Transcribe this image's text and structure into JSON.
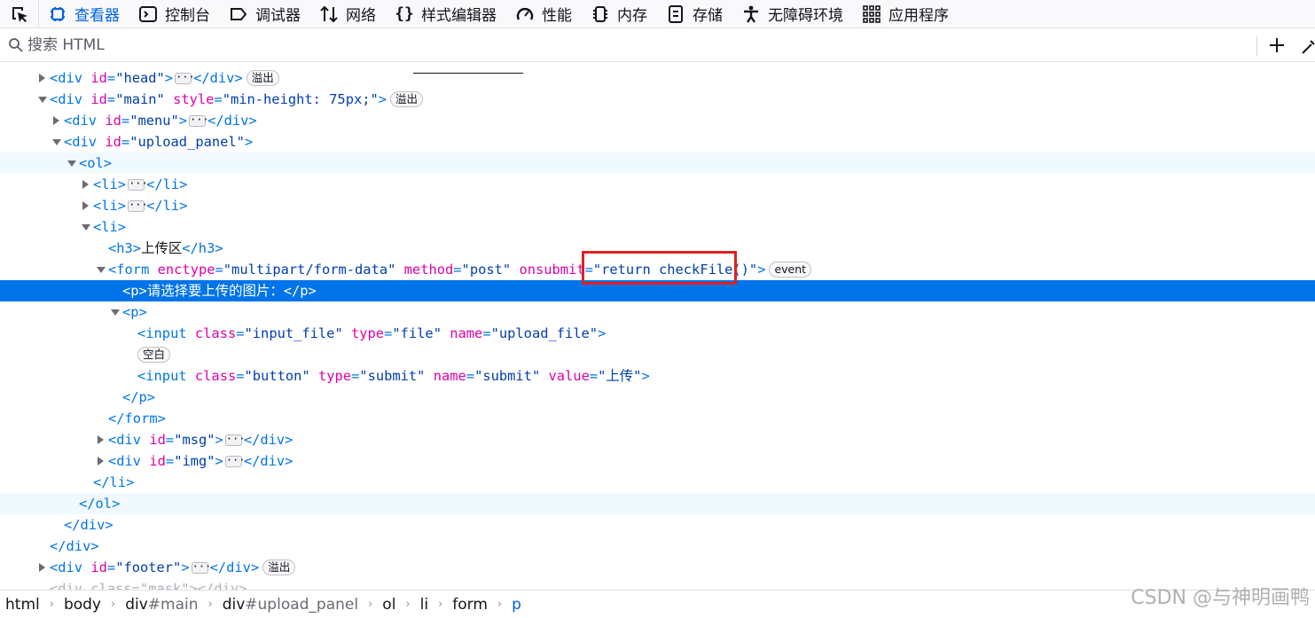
{
  "toolbar": {
    "tabs": [
      {
        "label": "查看器",
        "icon": "inspector-icon",
        "selected": true
      },
      {
        "label": "控制台",
        "icon": "console-icon"
      },
      {
        "label": "调试器",
        "icon": "debugger-icon"
      },
      {
        "label": "网络",
        "icon": "network-icon"
      },
      {
        "label": "样式编辑器",
        "icon": "style-editor-icon"
      },
      {
        "label": "性能",
        "icon": "performance-icon"
      },
      {
        "label": "内存",
        "icon": "memory-icon"
      },
      {
        "label": "存储",
        "icon": "storage-icon"
      },
      {
        "label": "无障碍环境",
        "icon": "accessibility-icon"
      },
      {
        "label": "应用程序",
        "icon": "application-icon"
      }
    ]
  },
  "search": {
    "placeholder": "搜索 HTML"
  },
  "tree": {
    "head_div": {
      "tag_open": "<div",
      "attr": "id",
      "value": "\"head\"",
      "close": "</div>",
      "badge": "溢出"
    },
    "main_div": {
      "attr1": "id",
      "value1": "\"main\"",
      "attr2": "style",
      "value2": "\"min-height: 75px;\"",
      "badge": "溢出"
    },
    "menu_div": {
      "attr": "id",
      "value": "\"menu\""
    },
    "upload_div": {
      "attr": "id",
      "value": "\"upload_panel\""
    },
    "h3_text": "上传区",
    "form": {
      "a1": "enctype",
      "v1": "\"multipart/form-data\"",
      "a2": "method",
      "v2": "\"post\"",
      "a3": "onsubmit",
      "v3": "\"return checkFile()\"",
      "badge": "event"
    },
    "selected_p_text": "请选择要上传的图片：",
    "input1": {
      "a1": "class",
      "v1": "\"input_file\"",
      "a2": "type",
      "v2": "\"file\"",
      "a3": "name",
      "v3": "\"upload_file\""
    },
    "whitespace_badge": "空白",
    "input2": {
      "a1": "class",
      "v1": "\"button\"",
      "a2": "type",
      "v2": "\"submit\"",
      "a3": "name",
      "v3": "\"submit\"",
      "a4": "value",
      "v4": "\"上传\""
    },
    "msg_div": {
      "attr": "id",
      "value": "\"msg\""
    },
    "img_div": {
      "attr": "id",
      "value": "\"img\""
    },
    "footer_div": {
      "attr": "id",
      "value": "\"footer\"",
      "badge": "溢出"
    },
    "mask_div_partial": "<div class=\"mask\"></div>"
  },
  "breadcrumbs": [
    {
      "tag": "html",
      "id": ""
    },
    {
      "tag": "body",
      "id": ""
    },
    {
      "tag": "div",
      "id": "#main"
    },
    {
      "tag": "div",
      "id": "#upload_panel"
    },
    {
      "tag": "ol",
      "id": ""
    },
    {
      "tag": "li",
      "id": ""
    },
    {
      "tag": "form",
      "id": ""
    },
    {
      "tag": "p",
      "id": "",
      "active": true
    }
  ],
  "watermark": "CSDN @与神明画鸭",
  "colors": {
    "selected_row": "#0074e8",
    "tag": "#0074e8",
    "attr_name": "#dd00a9",
    "attr_value": "#003eaa",
    "highlight_box": "#e02020"
  }
}
